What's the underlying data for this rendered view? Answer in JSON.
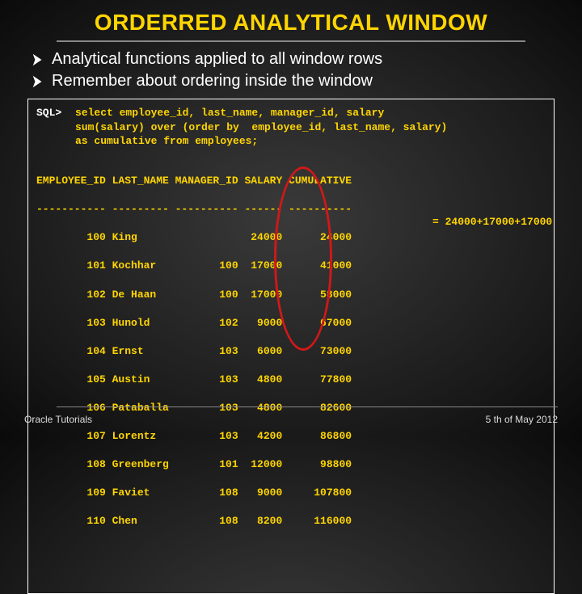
{
  "title": "ORDERRED ANALYTICAL WINDOW",
  "bullets": [
    "Analytical functions applied to all window rows",
    "Remember about ordering inside the window"
  ],
  "prompt": "SQL>",
  "sql": {
    "l1": "select employee_id, last_name, manager_id, salary",
    "l2": "sum(salary) over (order by  employee_id, last_name, salary)",
    "l3": "as cumulative from employees;"
  },
  "table": {
    "header": "EMPLOYEE_ID LAST_NAME MANAGER_ID SALARY CUMULATIVE",
    "divider": "----------- --------- ---------- ------ ----------",
    "rows": [
      "        100 King                  24000      24000",
      "        101 Kochhar          100  17000      41000",
      "        102 De Haan          100  17000      58000",
      "        103 Hunold           102   9000      67000",
      "        104 Ernst            103   6000      73000",
      "        105 Austin           103   4800      77800",
      "        106 Pataballa        103   4800      82600",
      "        107 Lorentz          103   4200      86800",
      "        108 Greenberg        101  12000      98800",
      "        109 Faviet           108   9000     107800",
      "        110 Chen             108   8200     116000"
    ]
  },
  "annotation": "= 24000+17000+17000",
  "footer": {
    "left": "Oracle Tutorials",
    "right": "5 th of May 2012"
  }
}
